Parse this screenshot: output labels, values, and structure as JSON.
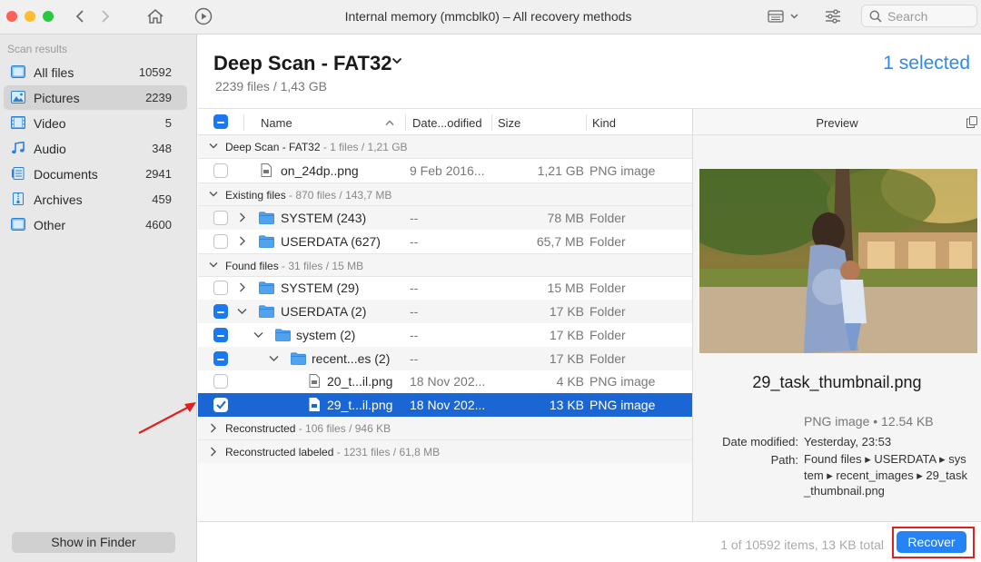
{
  "window": {
    "title": "Internal memory (mmcblk0) – All recovery methods",
    "search_placeholder": "Search"
  },
  "sidebar": {
    "heading": "Scan results",
    "items": [
      {
        "label": "All files",
        "count": "10592",
        "icon": "all-files-icon"
      },
      {
        "label": "Pictures",
        "count": "2239",
        "icon": "pictures-icon",
        "active": true
      },
      {
        "label": "Video",
        "count": "5",
        "icon": "video-icon"
      },
      {
        "label": "Audio",
        "count": "348",
        "icon": "audio-icon"
      },
      {
        "label": "Documents",
        "count": "2941",
        "icon": "documents-icon"
      },
      {
        "label": "Archives",
        "count": "459",
        "icon": "archives-icon"
      },
      {
        "label": "Other",
        "count": "4600",
        "icon": "other-icon"
      }
    ],
    "show_in_finder": "Show in Finder"
  },
  "header": {
    "title": "Deep Scan - FAT32",
    "subtitle": "2239 files / 1,43 GB",
    "selected": "1 selected"
  },
  "columns": {
    "name": "Name",
    "date": "Date...odified",
    "size": "Size",
    "kind": "Kind"
  },
  "groups": {
    "deep": {
      "title": "Deep Scan - FAT32",
      "meta": " - 1 files / 1,21 GB"
    },
    "existing": {
      "title": "Existing files",
      "meta": " - 870 files / 143,7 MB"
    },
    "found": {
      "title": "Found files",
      "meta": " - 31 files / 15 MB"
    },
    "reconstructed": {
      "title": "Reconstructed",
      "meta": " - 106 files / 946 KB"
    },
    "reconstructed_labeled": {
      "title": "Reconstructed labeled",
      "meta": " - 1231 files / 61,8 MB"
    }
  },
  "rows": {
    "deep_file": {
      "name": "on_24dp..png",
      "date": "9 Feb 2016...",
      "size": "1,21 GB",
      "kind": "PNG image"
    },
    "ex_system": {
      "name": "SYSTEM (243)",
      "date": "--",
      "size": "78 MB",
      "kind": "Folder"
    },
    "ex_userdata": {
      "name": "USERDATA (627)",
      "date": "--",
      "size": "65,7 MB",
      "kind": "Folder"
    },
    "fo_system": {
      "name": "SYSTEM (29)",
      "date": "--",
      "size": "15 MB",
      "kind": "Folder"
    },
    "fo_userdata": {
      "name": "USERDATA (2)",
      "date": "--",
      "size": "17 KB",
      "kind": "Folder"
    },
    "fo_sys_sub": {
      "name": "system (2)",
      "date": "--",
      "size": "17 KB",
      "kind": "Folder"
    },
    "fo_recent": {
      "name": "recent...es (2)",
      "date": "--",
      "size": "17 KB",
      "kind": "Folder"
    },
    "file_20": {
      "name": "20_t...il.png",
      "date": "18 Nov 202...",
      "size": "4 KB",
      "kind": "PNG image"
    },
    "file_29": {
      "name": "29_t...il.png",
      "date": "18 Nov 202...",
      "size": "13 KB",
      "kind": "PNG image"
    }
  },
  "preview": {
    "heading": "Preview",
    "filename": "29_task_thumbnail.png",
    "type_size": "PNG image • 12.54 KB",
    "date_label": "Date modified:",
    "date_value": "Yesterday, 23:53",
    "path_label": "Path:",
    "path_value": "Found files ▸ USERDATA ▸ system ▸ recent_images ▸ 29_task_thumbnail.png"
  },
  "footer": {
    "status": "1 of 10592 items, 13 KB total",
    "recover": "Recover"
  },
  "colors": {
    "accent": "#1a78f2",
    "selection": "#1966d4",
    "annotation": "#e02020"
  }
}
